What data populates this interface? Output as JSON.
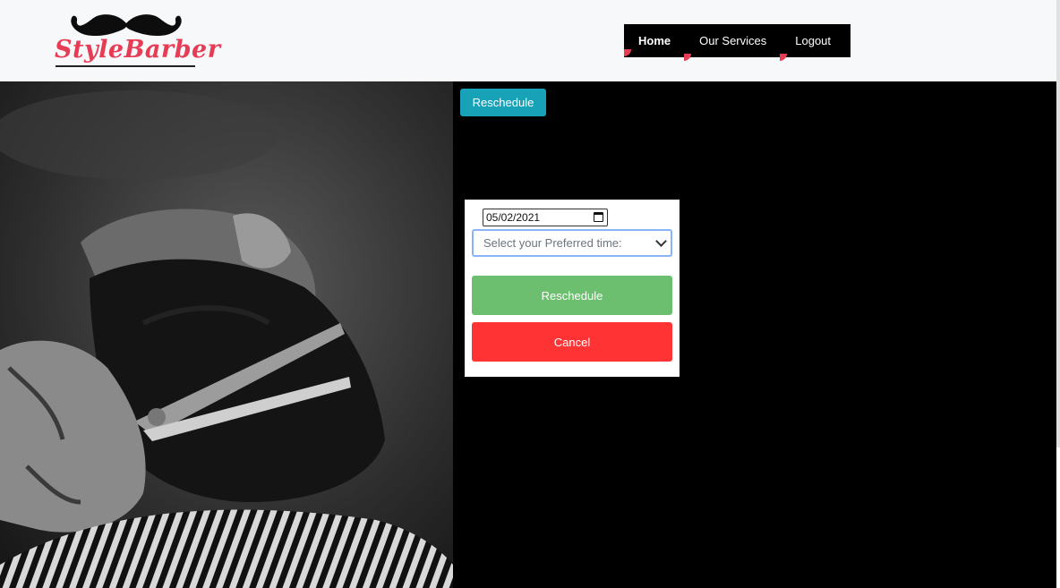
{
  "header": {
    "logo_text": "StyleBarber",
    "nav": {
      "home": "Home",
      "services": "Our Services",
      "logout": "Logout"
    }
  },
  "colors": {
    "brand": "#e73c55",
    "nav_background": "#000000",
    "accent_teal": "#17a2b8",
    "reschedule_green": "#6cbf6f",
    "cancel_red": "#ff3333"
  },
  "main": {
    "top_button": "Reschedule",
    "form": {
      "date_value": "05/02/2021",
      "time_placeholder": "Select your Preferred time:",
      "reschedule_label": "Reschedule",
      "cancel_label": "Cancel"
    }
  },
  "icons": [
    "mustache-icon",
    "calendar-icon",
    "chevron-down-icon"
  ]
}
